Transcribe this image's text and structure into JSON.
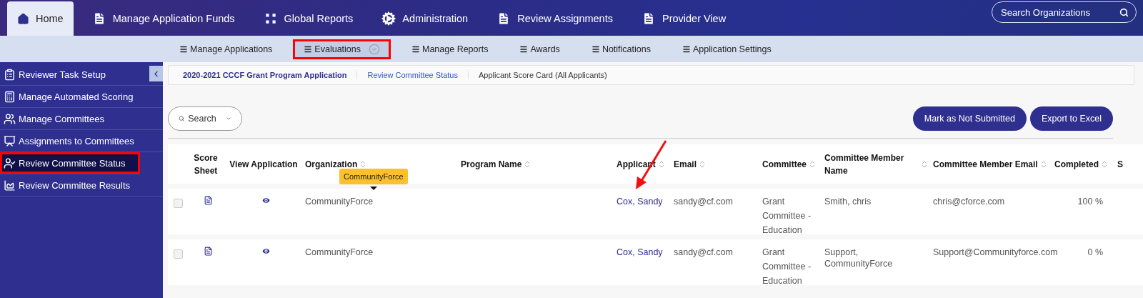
{
  "top_nav": {
    "tabs": [
      {
        "label": "Home",
        "selected": true
      },
      {
        "label": "Manage Application Funds",
        "selected": false
      },
      {
        "label": "Global Reports",
        "selected": false
      },
      {
        "label": "Administration",
        "selected": false
      },
      {
        "label": "Review Assignments",
        "selected": false
      },
      {
        "label": "Provider View",
        "selected": false
      }
    ],
    "search": {
      "placeholder": "Search Organizations"
    }
  },
  "sub_nav": {
    "items": [
      {
        "label": "Manage Applications",
        "selected": false,
        "highlighted": false
      },
      {
        "label": "Evaluations",
        "selected": true,
        "highlighted": true
      },
      {
        "label": "Manage Reports",
        "selected": false,
        "highlighted": false
      },
      {
        "label": "Awards",
        "selected": false,
        "highlighted": false
      },
      {
        "label": "Notifications",
        "selected": false,
        "highlighted": false
      },
      {
        "label": "Application Settings",
        "selected": false,
        "highlighted": false
      }
    ]
  },
  "sidebar": {
    "items": [
      {
        "label": "Reviewer Task Setup",
        "selected": false,
        "highlighted": false
      },
      {
        "label": "Manage Automated Scoring",
        "selected": false,
        "highlighted": false
      },
      {
        "label": "Manage Committees",
        "selected": false,
        "highlighted": false
      },
      {
        "label": "Assignments to Committees",
        "selected": false,
        "highlighted": false
      },
      {
        "label": "Review Committee Status",
        "selected": true,
        "highlighted": true
      },
      {
        "label": "Review Committee Results",
        "selected": false,
        "highlighted": false
      }
    ]
  },
  "breadcrumb": [
    {
      "label": "2020-2021 CCCF Grant Program Application",
      "kind": "root"
    },
    {
      "label": "Review Committee Status",
      "kind": "link"
    },
    {
      "label": "Applicant Score Card (All Applicants)",
      "kind": "current"
    }
  ],
  "search_button": {
    "label": "Search"
  },
  "actions": [
    "Mark as Not Submitted",
    "Export to Excel"
  ],
  "table": {
    "columns": [
      {
        "label": "Score Sheet",
        "sortable": false
      },
      {
        "label": "View Application",
        "sortable": false
      },
      {
        "label": "Organization",
        "sortable": true
      },
      {
        "label": "Program Name",
        "sortable": true
      },
      {
        "label": "Applicant",
        "sortable": true
      },
      {
        "label": "Email",
        "sortable": true
      },
      {
        "label": "Committee",
        "sortable": true
      },
      {
        "label": "Committee Member Name",
        "sortable": true
      },
      {
        "label": "Committee Member Email",
        "sortable": true
      },
      {
        "label": "Completed",
        "sortable": true
      },
      {
        "label": "S",
        "sortable": false
      }
    ],
    "rows": [
      {
        "checked": false,
        "organization": "CommunityForce",
        "tooltip": "CommunityForce",
        "applicant": "Cox, Sandy",
        "email": "sandy@cf.com",
        "committee": "Grant Committee - Education",
        "member_name": "Smith, chris",
        "member_email": "chris@cforce.com",
        "completed": "100 %"
      },
      {
        "checked": false,
        "organization": "CommunityForce",
        "applicant": "Cox, Sandy",
        "email": "sandy@cf.com",
        "committee": "Grant Committee - Education",
        "member_name": "Support, CommunityForce",
        "member_email": "Support@Communityforce.com",
        "completed": "0 %"
      }
    ]
  },
  "annotation_arrow": true
}
